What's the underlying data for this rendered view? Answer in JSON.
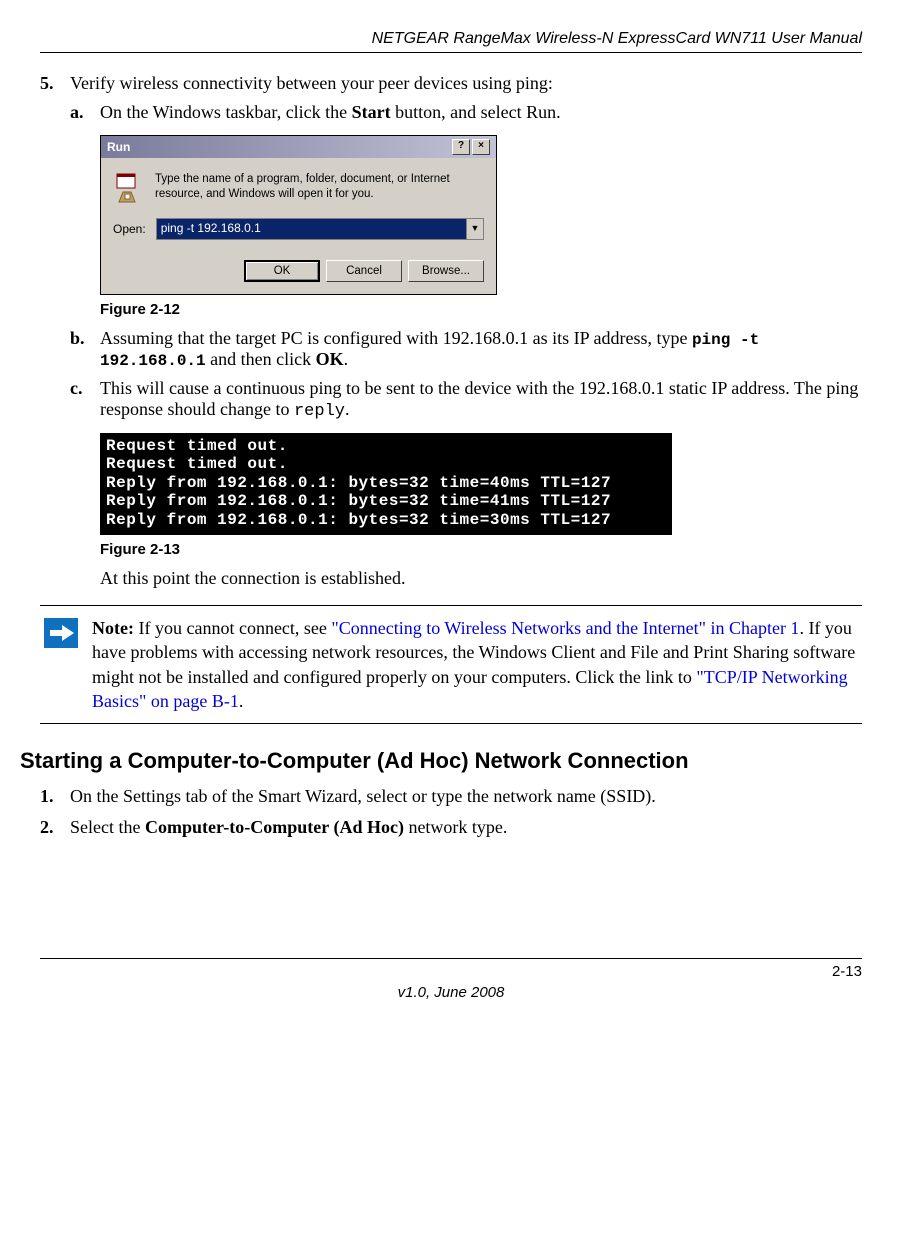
{
  "header": {
    "title": "NETGEAR RangeMax Wireless-N ExpressCard WN711 User Manual"
  },
  "steps": {
    "s5": {
      "num": "5.",
      "text": "Verify wireless connectivity between your peer devices using ping:",
      "a": {
        "num": "a.",
        "pre": "On the Windows taskbar, click the ",
        "bold": "Start",
        "post": " button, and select Run."
      },
      "b": {
        "num": "b.",
        "pre": "Assuming that the target PC is configured with 192.168.0.1 as its IP address, type ",
        "code": "ping -t 192.168.0.1",
        "mid": " and then click ",
        "bold": "OK",
        "post": "."
      },
      "c": {
        "num": "c.",
        "pre": "This will cause a continuous ping to be sent to the device with the 192.168.0.1 static IP address. The ping response should change to ",
        "code": "reply",
        "post": "."
      },
      "after_console": "At this point the connection is established."
    }
  },
  "run_dialog": {
    "title": "Run",
    "help_btn": "?",
    "close_btn": "×",
    "desc": "Type the name of a program, folder, document, or Internet resource, and Windows will open it for you.",
    "open_label": "Open:",
    "input_value": "ping -t 192.168.0.1",
    "ok": "OK",
    "cancel": "Cancel",
    "browse": "Browse..."
  },
  "figures": {
    "f12": "Figure 2-12",
    "f13": "Figure 2-13"
  },
  "console_lines": "Request timed out.\nRequest timed out.\nReply from 192.168.0.1: bytes=32 time=40ms TTL=127\nReply from 192.168.0.1: bytes=32 time=41ms TTL=127\nReply from 192.168.0.1: bytes=32 time=30ms TTL=127",
  "note": {
    "label": "Note:",
    "t1": " If you cannot connect, see ",
    "link1": "\"Connecting to Wireless Networks and the Internet\" in Chapter 1",
    "t2": ". If you have problems with accessing network resources, the Windows Client and File and Print Sharing software might not be installed and configured properly on your computers. Click the link to ",
    "link2": "\"TCP/IP Networking Basics\" on page B-1",
    "t3": "."
  },
  "section_h": "Starting a Computer-to-Computer (Ad Hoc) Network Connection",
  "adhoc": {
    "s1": {
      "num": "1.",
      "text": "On the Settings tab of the Smart Wizard, select or type the network name (SSID)."
    },
    "s2": {
      "num": "2.",
      "pre": "Select the ",
      "bold": "Computer-to-Computer (Ad Hoc)",
      "post": " network type."
    }
  },
  "footer": {
    "page": "2-13",
    "version": "v1.0, June 2008"
  }
}
